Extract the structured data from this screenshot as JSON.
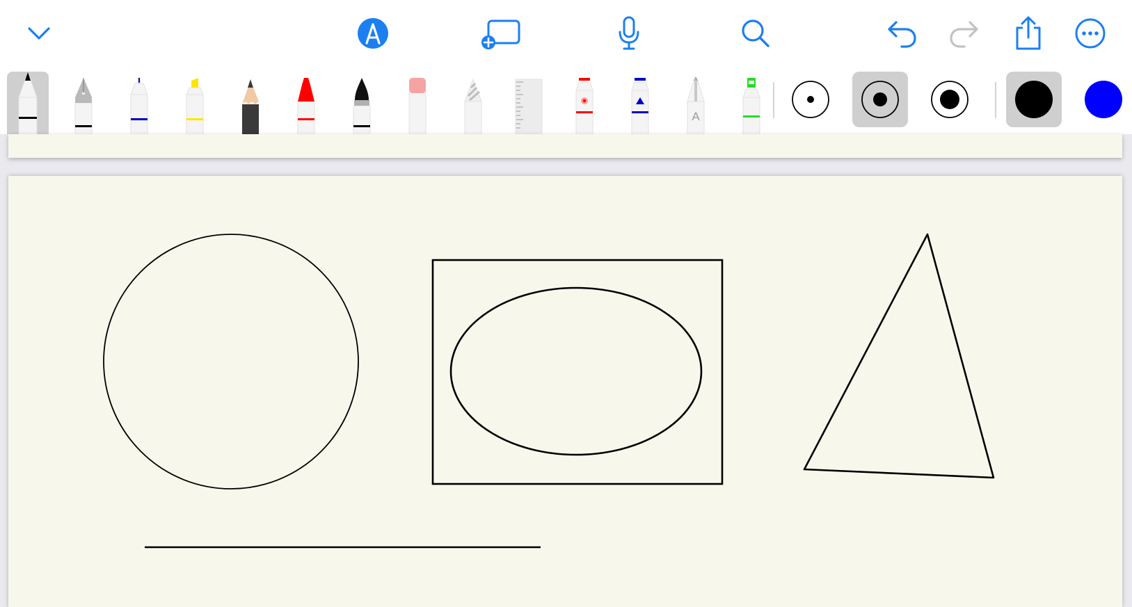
{
  "colors": {
    "accent": "#1b7ff2",
    "disabled": "#c2c2c2",
    "paper": "#f8f7ec",
    "selected_bg": "#cfcfcf",
    "ink_black": "#000000",
    "ink_blue": "#0000ff"
  },
  "toolbar": {
    "collapse_icon": "chevron-down-icon",
    "markup_icon": "pen-markup-circle-icon",
    "add_page_icon": "add-page-icon",
    "mic_icon": "microphone-icon",
    "search_icon": "search-icon",
    "undo_icon": "undo-icon",
    "redo_icon": "redo-icon",
    "share_icon": "share-icon",
    "more_icon": "more-ellipsis-icon",
    "redo_enabled": false
  },
  "tools": [
    {
      "name": "monoline-pen",
      "color": "#000000",
      "selected": true
    },
    {
      "name": "fountain-pen",
      "color": "#000000",
      "selected": false
    },
    {
      "name": "fineliner",
      "color": "#0000cc",
      "selected": false
    },
    {
      "name": "highlighter",
      "color": "#ffe600",
      "selected": false
    },
    {
      "name": "pencil",
      "color": "#3a3a3a",
      "selected": false
    },
    {
      "name": "crayon",
      "color": "#ff0000",
      "selected": false
    },
    {
      "name": "watercolor-brush",
      "color": "#000000",
      "selected": false
    },
    {
      "name": "eraser",
      "color": "#f5a3a3",
      "selected": false
    },
    {
      "name": "lasso",
      "color": "#bdbdbd",
      "selected": false
    },
    {
      "name": "ruler",
      "color": "#bdbdbd",
      "selected": false
    },
    {
      "name": "laser-pointer",
      "color": "#ff0000",
      "selected": false
    },
    {
      "name": "shape-tool",
      "color": "#0000cc",
      "selected": false
    },
    {
      "name": "text-tool",
      "color": "#9b9b9b",
      "selected": false,
      "glyph": "A"
    },
    {
      "name": "green-marker",
      "color": "#22dd22",
      "selected": false
    }
  ],
  "widths": [
    {
      "name": "thin",
      "selected": false
    },
    {
      "name": "medium",
      "selected": true
    },
    {
      "name": "thick",
      "selected": false
    }
  ],
  "palette": [
    {
      "name": "black",
      "color": "#000000",
      "selected": true
    },
    {
      "name": "blue",
      "color": "#0000ff",
      "selected": false
    }
  ],
  "drawing": {
    "shapes": [
      "circle",
      "rectangle",
      "ellipse",
      "triangle",
      "line"
    ]
  }
}
